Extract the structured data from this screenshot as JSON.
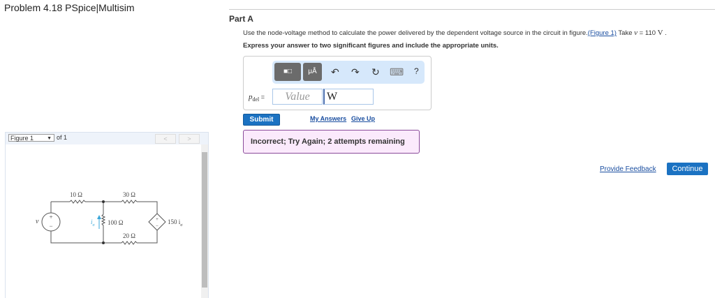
{
  "page_title": "Problem 4.18 PSpice|Multisim",
  "part": "Part A",
  "question": {
    "text": "Use the node-voltage method to calculate the power delivered by the dependent voltage source in the circuit in figure.",
    "figure_link": "(Figure 1)",
    "take": " Take ",
    "var": "v",
    "eq": " = 110 ",
    "unit": "V",
    "end": " ."
  },
  "instructions": "Express your answer to two significant figures and include the appropriate units.",
  "toolbar": {
    "templates": "■□",
    "units": "μÅ",
    "undo": "↶",
    "redo": "↷",
    "reset": "↻",
    "keyboard": "⌨",
    "help": "?"
  },
  "answer": {
    "label": "p",
    "sub": "del",
    "eq": " =",
    "value_placeholder": "Value",
    "unit": "W"
  },
  "submit": "Submit",
  "my_answers": "My Answers",
  "give_up": "Give Up",
  "feedback_message": "Incorrect; Try Again; 2 attempts remaining",
  "provide_feedback": "Provide Feedback",
  "continue": "Continue",
  "figure": {
    "selected": "Figure 1",
    "of": "of 1",
    "prev": "<",
    "next": ">",
    "circuit": {
      "r1": "10 Ω",
      "r2": "30 Ω",
      "r3": "100 Ω",
      "r4": "20 Ω",
      "src": "v",
      "dep": "150 i",
      "dep_sub": "σ",
      "current": "i",
      "current_sub": "σ"
    }
  }
}
